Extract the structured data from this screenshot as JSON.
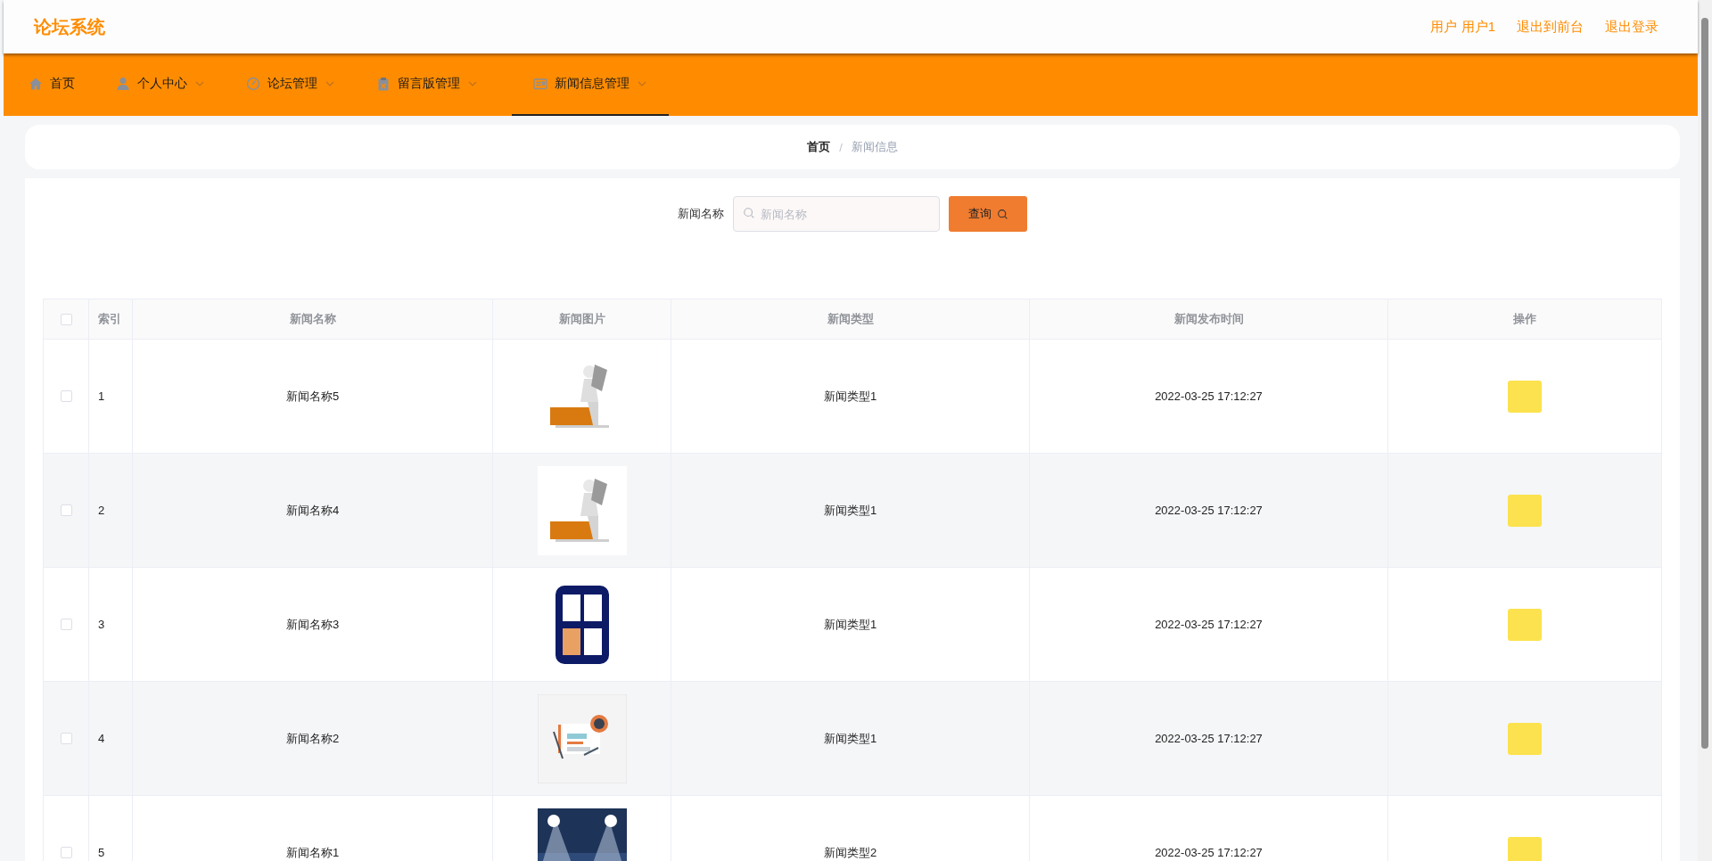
{
  "header": {
    "title": "论坛系统",
    "links": [
      "用户 用户1",
      "退出到前台",
      "退出登录"
    ]
  },
  "nav": [
    {
      "label": "首页",
      "has_menu": false,
      "selected": false
    },
    {
      "label": "个人中心",
      "has_menu": true,
      "selected": false
    },
    {
      "label": "论坛管理",
      "has_menu": true,
      "selected": false
    },
    {
      "label": "留言版管理",
      "has_menu": true,
      "selected": false
    },
    {
      "label": "新闻信息管理",
      "has_menu": true,
      "selected": true
    }
  ],
  "breadcrumb": {
    "separator": "/",
    "items": [
      "首页",
      "新闻信息"
    ]
  },
  "search": {
    "label": "新闻名称",
    "placeholder": "新闻名称",
    "button": "查询"
  },
  "table": {
    "select_all": {
      "checked": false
    },
    "columns": [
      "索引",
      "新闻名称",
      "新闻图片",
      "新闻类型",
      "新闻发布时间",
      "操作"
    ],
    "rows": [
      {
        "checked": false,
        "index": "1",
        "name": "新闻名称5",
        "type": "新闻类型1",
        "time": "2022-03-25 17:12:27"
      },
      {
        "checked": false,
        "index": "2",
        "name": "新闻名称4",
        "type": "新闻类型1",
        "time": "2022-03-25 17:12:27"
      },
      {
        "checked": false,
        "index": "3",
        "name": "新闻名称3",
        "type": "新闻类型1",
        "time": "2022-03-25 17:12:27"
      },
      {
        "checked": false,
        "index": "4",
        "name": "新闻名称2",
        "type": "新闻类型1",
        "time": "2022-03-25 17:12:27"
      },
      {
        "checked": false,
        "index": "5",
        "name": "新闻名称1",
        "type": "新闻类型2",
        "time": "2022-03-25 17:12:27"
      }
    ]
  }
}
